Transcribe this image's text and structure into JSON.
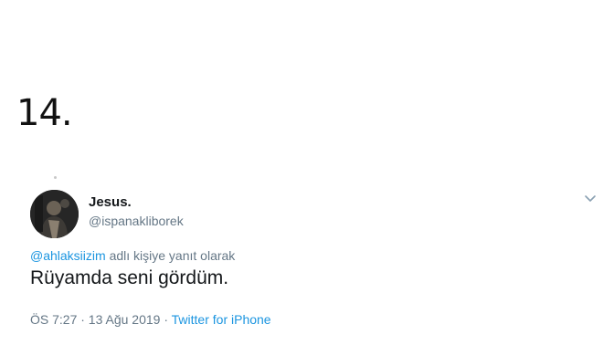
{
  "list": {
    "number": "14."
  },
  "tweet": {
    "display_name": "Jesus.",
    "handle": "@ispanakliborek",
    "reply_mention": "@ahlaksiizim",
    "reply_suffix": "adlı kişiye yanıt olarak",
    "text": "Rüyamda seni gördüm.",
    "timestamp": "ÖS 7:27 · 13 Ağu 2019",
    "meta_separator": "·",
    "source": "Twitter for iPhone",
    "avatar_icon": "profile-photo",
    "menu_icon": "chevron-down-icon"
  },
  "colors": {
    "link": "#1b95e0",
    "secondary_text": "#657786",
    "primary_text": "#14171a"
  }
}
